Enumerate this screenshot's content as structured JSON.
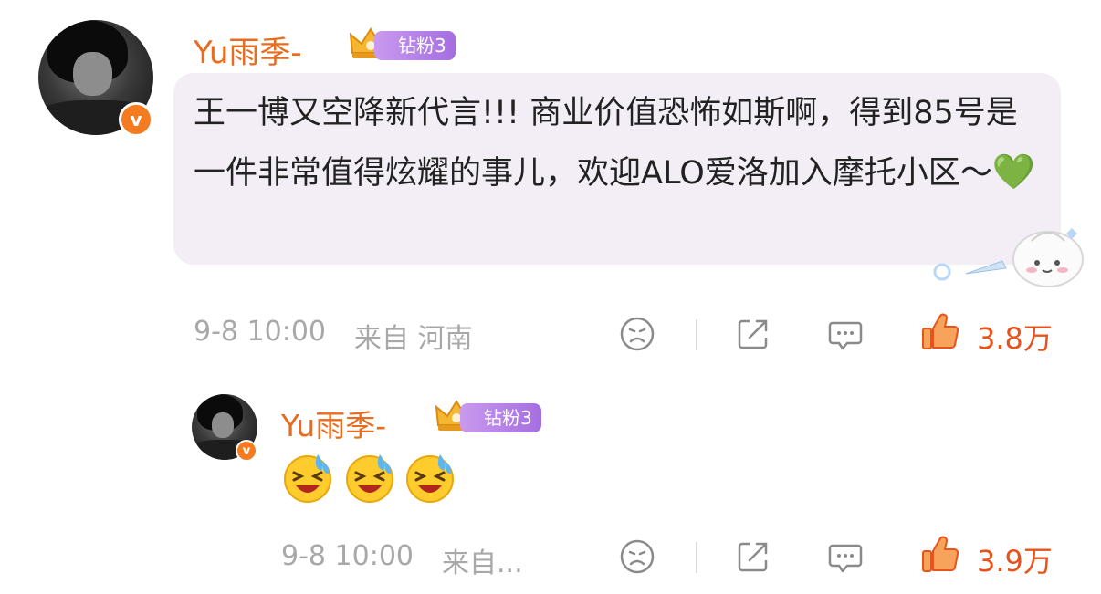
{
  "comment": {
    "username": "Yu雨季-",
    "fan_badge": "钻粉3",
    "text": "王一博又空降新代言!!! 商业价值恐怖如斯啊，得到85号是一件非常值得炫耀的事儿，欢迎ALO爱洛加入摩托小区～",
    "emoji": "💚",
    "timestamp": "9-8 10:00",
    "location": "来自 河南",
    "like_count": "3.8万"
  },
  "reply": {
    "username": "Yu雨季-",
    "fan_badge": "钻粉3",
    "emoji_names": [
      "laugh-cry-emoji",
      "laugh-cry-emoji",
      "laugh-cry-emoji"
    ],
    "timestamp": "9-8 10:00",
    "location": "来自...",
    "like_count": "3.9万"
  },
  "icons": [
    "dislike-icon",
    "share-icon",
    "comment-icon",
    "like-icon"
  ],
  "colors": {
    "username": "#e86c1f",
    "like": "#e8531c",
    "badge": "#a56ee0",
    "verified": "#f47b20",
    "bubble": "#f3eef6",
    "meta": "#a8a8a8"
  }
}
